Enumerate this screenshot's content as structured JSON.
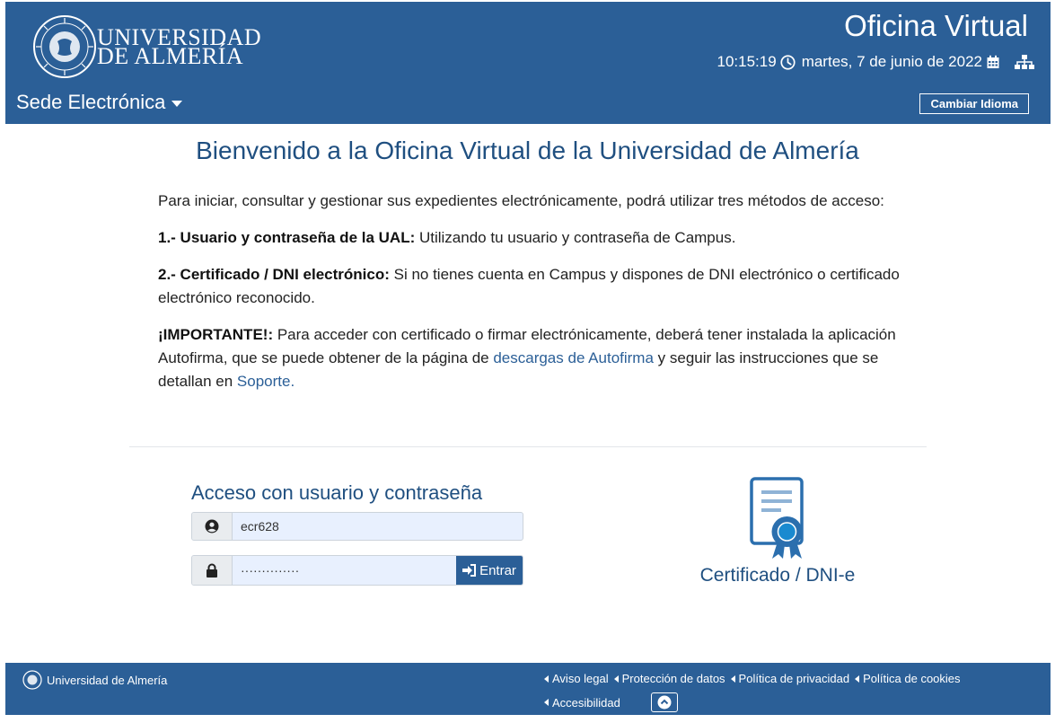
{
  "header": {
    "logo_line1": "UNIVERSIDAD",
    "logo_line2": "DE ALMERÍA",
    "title": "Oficina Virtual",
    "time": "10:15:19",
    "date": "martes, 7 de junio de 2022",
    "sede_label": "Sede Electrónica",
    "language_button": "Cambiar Idioma"
  },
  "main": {
    "welcome": "Bienvenido a la Oficina Virtual de la Universidad de Almería",
    "intro": "Para iniciar, consultar y gestionar sus expedientes electrónicamente, podrá utilizar tres métodos de acceso:",
    "method1_label": "1.- Usuario y contraseña de la UAL:",
    "method1_text": " Utilizando tu usuario y contraseña de Campus.",
    "method2_label": "2.- Certificado / DNI electrónico:",
    "method2_text": " Si no tienes cuenta en Campus y dispones de DNI electrónico o certificado electrónico reconocido.",
    "important_label": "¡IMPORTANTE!:",
    "important_text1": " Para acceder con certificado o firmar electrónicamente, deberá tener instalada la aplicación Autofirma, que se puede obtener de la página de ",
    "important_link1": "descargas de Autofirma",
    "important_text2": " y seguir las instrucciones que se detallan en ",
    "important_link2": "Soporte."
  },
  "login": {
    "title": "Acceso con usuario y contraseña",
    "username_value": "ecr628",
    "password_value": "··············",
    "submit_label": "Entrar"
  },
  "certificate": {
    "label": "Certificado / DNI-e"
  },
  "footer": {
    "university": "Universidad de Almería",
    "links": [
      "Aviso legal",
      "Protección de datos",
      "Política de privacidad",
      "Política de cookies",
      "Accesibilidad"
    ]
  },
  "colors": {
    "brand_blue": "#2b5f97",
    "heading_blue": "#1f4f80",
    "input_bg": "#e8f0fe"
  },
  "icons": [
    "university-seal-icon",
    "clock-icon",
    "calendar-icon",
    "sitemap-icon",
    "user-icon",
    "lock-icon",
    "sign-in-icon",
    "certificate-icon",
    "chevron-up-icon"
  ]
}
